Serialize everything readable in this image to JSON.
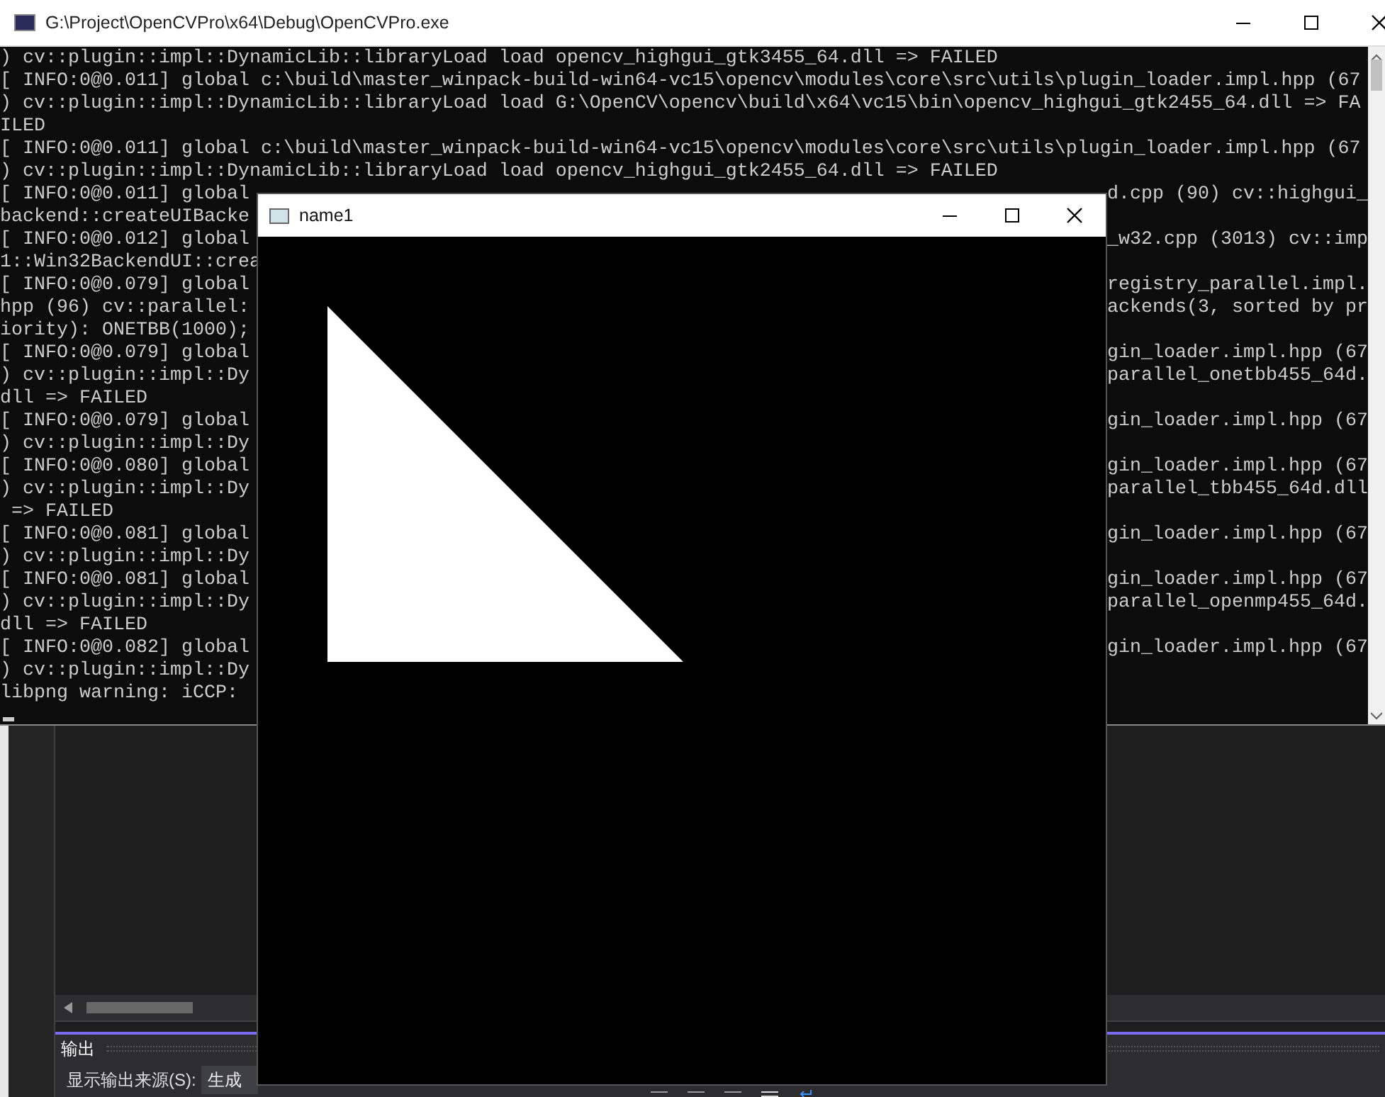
{
  "console": {
    "title": "G:\\Project\\OpenCVPro\\x64\\Debug\\OpenCVPro.exe",
    "lines": [
      {
        "text": ") cv::plugin::impl::DynamicLib::libraryLoad load opencv_highgui_gtk3455_64.dll => FAILED"
      },
      {
        "text": "[ INFO:0@0.011] global c:\\build\\master_winpack-build-win64-vc15\\opencv\\modules\\core\\src\\utils\\plugin_loader.impl.hpp (67"
      },
      {
        "text": ") cv::plugin::impl::DynamicLib::libraryLoad load G:\\OpenCV\\opencv\\build\\x64\\vc15\\bin\\opencv_highgui_gtk2455_64.dll => FA"
      },
      {
        "text": "ILED"
      },
      {
        "text": "[ INFO:0@0.011] global c:\\build\\master_winpack-build-win64-vc15\\opencv\\modules\\core\\src\\utils\\plugin_loader.impl.hpp (67"
      },
      {
        "text": ") cv::plugin::impl::DynamicLib::libraryLoad load opencv_highgui_gtk2455_64.dll => FAILED"
      },
      {
        "left": "[ INFO:0@0.011] global",
        "right": "d.cpp (90) cv::highgui_"
      },
      {
        "left": "backend::createUIBacke"
      },
      {
        "left": "[ INFO:0@0.012] global",
        "right": "_w32.cpp (3013) cv::imp"
      },
      {
        "left": "1::Win32BackendUI::crea"
      },
      {
        "left": "[ INFO:0@0.079] global",
        "right": "registry_parallel.impl."
      },
      {
        "left": "hpp (96) cv::parallel:",
        "right": "ackends(3, sorted by pr"
      },
      {
        "left": "iority): ONETBB(1000);"
      },
      {
        "left": "[ INFO:0@0.079] global",
        "right": "gin_loader.impl.hpp (67"
      },
      {
        "left": ") cv::plugin::impl::Dy",
        "right": "parallel_onetbb455_64d."
      },
      {
        "text": "dll => FAILED"
      },
      {
        "left": "[ INFO:0@0.079] global",
        "right": "gin_loader.impl.hpp (67"
      },
      {
        "left": ") cv::plugin::impl::Dy"
      },
      {
        "left": "[ INFO:0@0.080] global",
        "right": "gin_loader.impl.hpp (67"
      },
      {
        "left": ") cv::plugin::impl::Dy",
        "right": "parallel_tbb455_64d.dll"
      },
      {
        "text": " => FAILED"
      },
      {
        "left": "[ INFO:0@0.081] global",
        "right": "gin_loader.impl.hpp (67"
      },
      {
        "left": ") cv::plugin::impl::Dy"
      },
      {
        "left": "[ INFO:0@0.081] global",
        "right": "gin_loader.impl.hpp (67"
      },
      {
        "left": ") cv::plugin::impl::Dy",
        "right": "parallel_openmp455_64d."
      },
      {
        "text": "dll => FAILED"
      },
      {
        "left": "[ INFO:0@0.082] global",
        "right": "gin_loader.impl.hpp (67"
      },
      {
        "left": ") cv::plugin::impl::Dy"
      },
      {
        "left": "libpng warning: iCCP: "
      }
    ]
  },
  "image_window": {
    "title": "name1"
  },
  "output_panel": {
    "title": "输出",
    "source_label": "显示输出来源(S):",
    "source_value": "生成"
  }
}
